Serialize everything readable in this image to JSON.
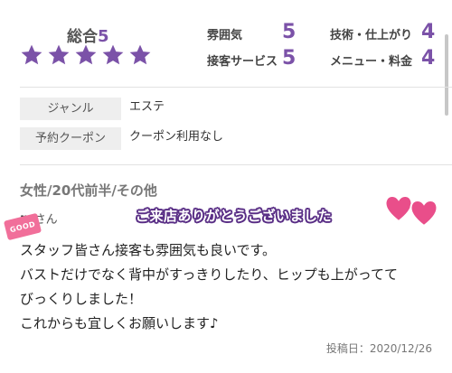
{
  "ratings": {
    "overall_label": "総合",
    "overall_value": "5",
    "stars": 5,
    "star_color": "#7b52a8",
    "items": [
      {
        "label": "雰囲気",
        "value": "5"
      },
      {
        "label": "技術・仕上がり",
        "value": "4"
      },
      {
        "label": "接客サービス",
        "value": "5"
      },
      {
        "label": "メニュー・料金",
        "value": "4"
      }
    ]
  },
  "info": {
    "genre_label": "ジャンル",
    "genre_value": "エステ",
    "coupon_label": "予約クーポン",
    "coupon_value": "クーポン利用なし"
  },
  "review": {
    "demographics": "女性/20代前半/その他",
    "reviewer_initial": "m",
    "reviewer_suffix": "さん",
    "badge_text": "GOOD",
    "thanks_text": "ご来店ありがとうございました",
    "heart_color": "#e94e8a",
    "body_lines": [
      "スタッフ皆さん接客も雰囲気も良いです。",
      "バストだけでなく背中がすっきりしたり、ヒップも上がってて",
      "びっくりしました！",
      "これからも宜しくお願いします♪"
    ],
    "posted": "投稿日：2020/12/26"
  }
}
